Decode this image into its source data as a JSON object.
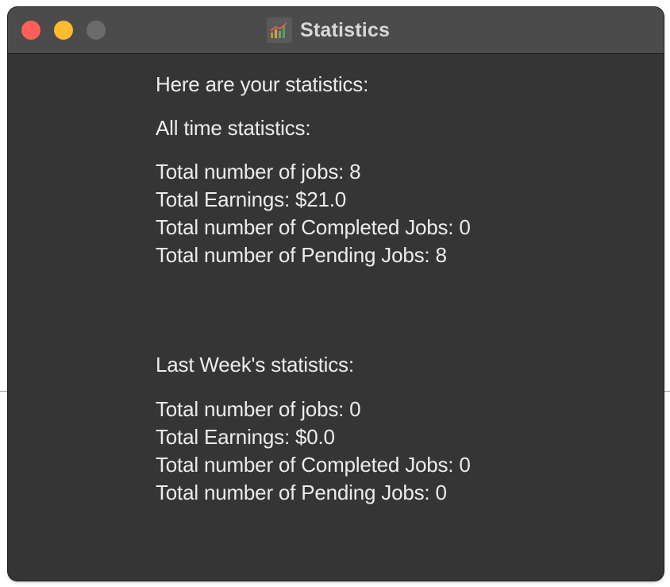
{
  "window": {
    "title": "Statistics",
    "app_icon": "bar-chart-icon",
    "controls": {
      "close_color": "#ff5f57",
      "minimize_color": "#febc2e",
      "zoom_color": "#6b6b6b"
    }
  },
  "stats": {
    "intro": "Here are your statistics:",
    "all_time": {
      "heading": "All time statistics:",
      "total_jobs": "Total number of jobs: 8",
      "total_earnings": "Total Earnings: $21.0",
      "completed_jobs": "Total number of Completed Jobs: 0",
      "pending_jobs": "Total number of Pending Jobs: 8"
    },
    "last_week": {
      "heading": "Last Week's statistics:",
      "total_jobs": "Total number of jobs: 0",
      "total_earnings": "Total Earnings: $0.0",
      "completed_jobs": "Total number of Completed Jobs: 0",
      "pending_jobs": "Total number of Pending Jobs: 0"
    }
  },
  "colors": {
    "window_bg": "#353535",
    "titlebar_bg": "#4b4b4b",
    "text": "#ececec"
  }
}
